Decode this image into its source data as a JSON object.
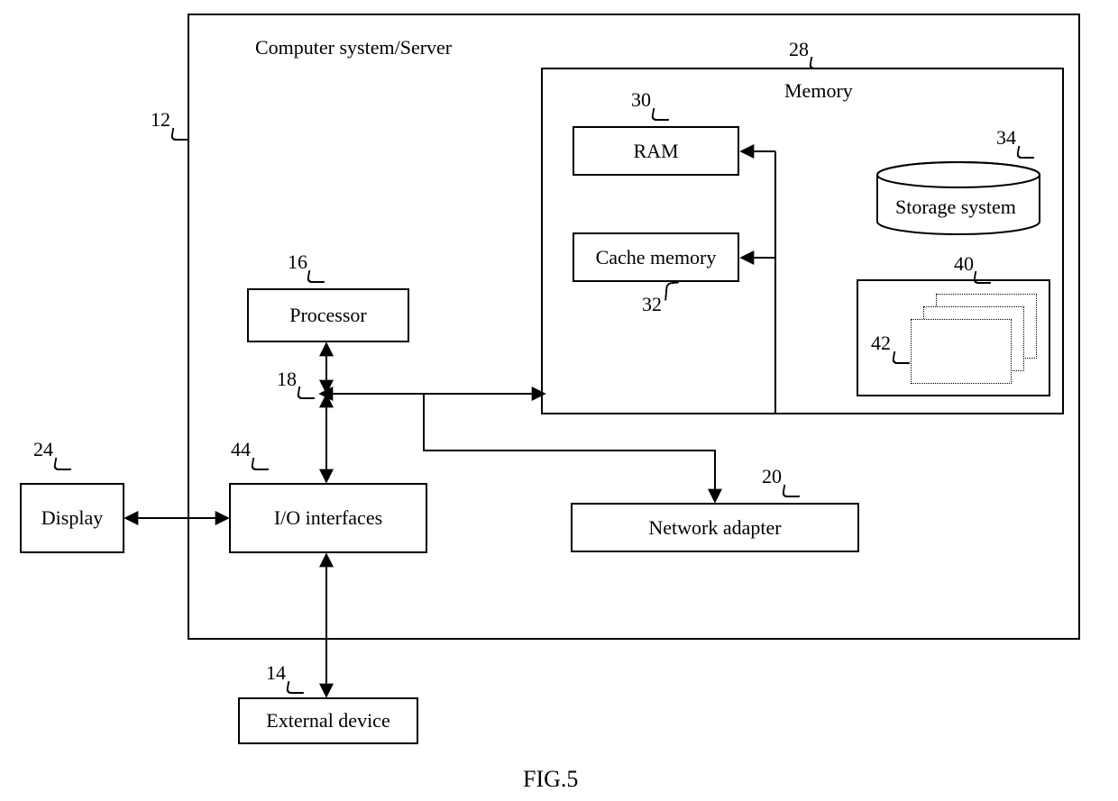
{
  "figure": "FIG.5",
  "system": {
    "title": "Computer system/Server",
    "ref": "12"
  },
  "memory": {
    "title": "Memory",
    "ref": "28",
    "ram": {
      "label": "RAM",
      "ref": "30"
    },
    "cache": {
      "label": "Cache memory",
      "ref": "32"
    },
    "storage": {
      "label": "Storage system",
      "ref": "34"
    },
    "modules": {
      "ref_outer": "40",
      "ref_inner": "42"
    }
  },
  "processor": {
    "label": "Processor",
    "ref": "16"
  },
  "bus": {
    "ref": "18"
  },
  "io": {
    "label": "I/O interfaces",
    "ref": "44"
  },
  "display": {
    "label": "Display",
    "ref": "24"
  },
  "external": {
    "label": "External device",
    "ref": "14"
  },
  "network": {
    "label": "Network adapter",
    "ref": "20"
  }
}
